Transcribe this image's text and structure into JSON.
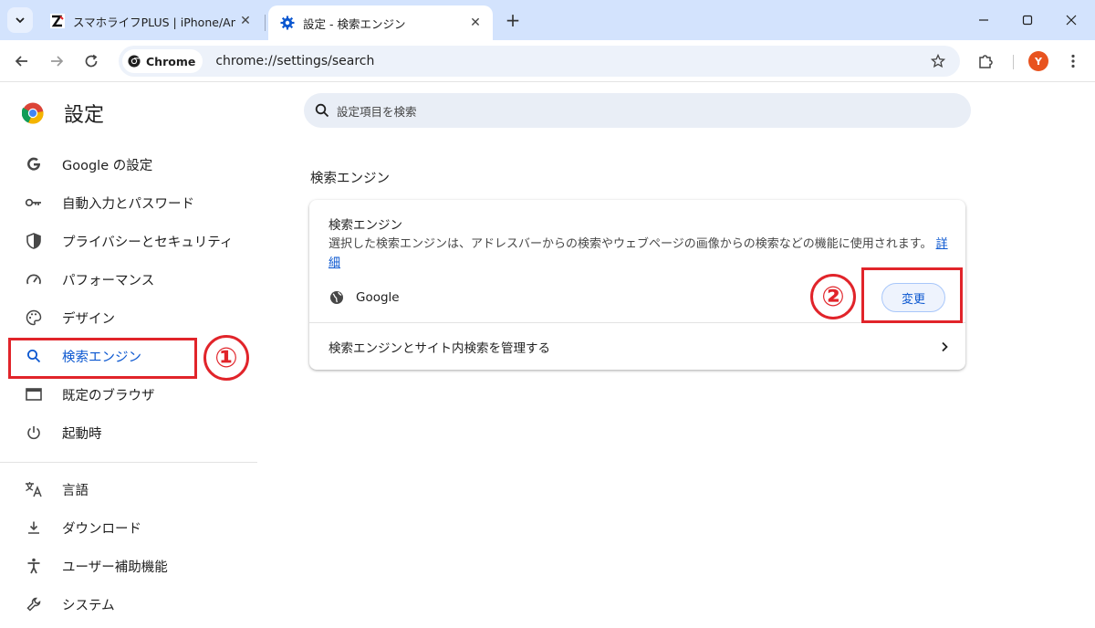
{
  "tabs": [
    {
      "title": "スマホライフPLUS | iPhone/Android",
      "active": false
    },
    {
      "title": "設定 - 検索エンジン",
      "active": true
    }
  ],
  "toolbar": {
    "chip_label": "Chrome",
    "url": "chrome://settings/search",
    "avatar_letter": "Y"
  },
  "settings": {
    "title": "設定",
    "search_placeholder": "設定項目を検索",
    "nav": [
      {
        "label": "Google の設定",
        "icon": "google-g-icon"
      },
      {
        "label": "自動入力とパスワード",
        "icon": "key-icon"
      },
      {
        "label": "プライバシーとセキュリティ",
        "icon": "shield-icon"
      },
      {
        "label": "パフォーマンス",
        "icon": "gauge-icon"
      },
      {
        "label": "デザイン",
        "icon": "palette-icon"
      },
      {
        "label": "検索エンジン",
        "icon": "search-icon",
        "selected": true
      },
      {
        "label": "既定のブラウザ",
        "icon": "browser-window-icon"
      },
      {
        "label": "起動時",
        "icon": "power-icon"
      },
      {
        "label": "言語",
        "icon": "translate-icon"
      },
      {
        "label": "ダウンロード",
        "icon": "download-icon"
      },
      {
        "label": "ユーザー補助機能",
        "icon": "accessibility-icon"
      },
      {
        "label": "システム",
        "icon": "wrench-icon"
      }
    ],
    "section_title": "検索エンジン",
    "card": {
      "heading": "検索エンジン",
      "description": "選択した検索エンジンは、アドレスバーからの検索やウェブページの画像からの検索などの機能に使用されます。",
      "learn_more": "詳細",
      "current_engine": "Google",
      "change_label": "変更",
      "manage_label": "検索エンジンとサイト内検索を管理する"
    }
  },
  "annotations": {
    "marker_1": "①",
    "marker_2": "②",
    "color": "#e1242a"
  }
}
